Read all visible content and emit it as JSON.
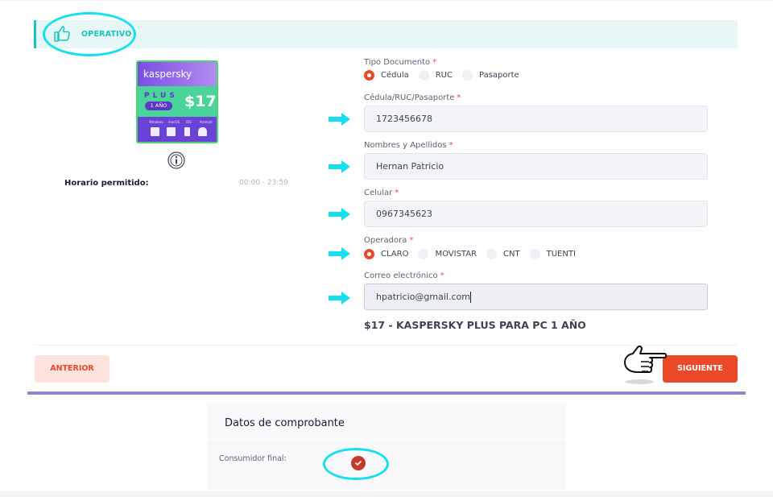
{
  "status": {
    "label": "OPERATIVO",
    "icon": "thumbs-up-icon"
  },
  "product": {
    "brand": "kaspersky",
    "plan": "PLUS",
    "duration": "1 AÑO",
    "price": "$17",
    "platforms": [
      "Windows",
      "macOS",
      "iOS",
      "Android"
    ]
  },
  "schedule": {
    "label": "Horario permitido:",
    "value": "00:00 - 23:59"
  },
  "form": {
    "doc_type": {
      "label": "Tipo Documento",
      "required_mark": "*",
      "options": [
        "Cédula",
        "RUC",
        "Pasaporte"
      ],
      "selected": "Cédula"
    },
    "doc_number": {
      "label": "Cédula/RUC/Pasaporte",
      "required_mark": "*",
      "value": "1723456678"
    },
    "name": {
      "label": "Nombres y Apellidos",
      "required_mark": "*",
      "value": "Hernan Patricio"
    },
    "phone": {
      "label": "Celular",
      "required_mark": "*",
      "value": "0967345623"
    },
    "operator": {
      "label": "Operadora",
      "required_mark": "*",
      "options": [
        "CLARO",
        "MOVISTAR",
        "CNT",
        "TUENTI"
      ],
      "selected": "CLARO"
    },
    "email": {
      "label": "Correo electrónico",
      "required_mark": "*",
      "value": "hpatricio@gmail.com"
    },
    "summary": "$17 - KASPERSKY PLUS PARA PC 1 AÑO"
  },
  "nav": {
    "prev_label": "ANTERIOR",
    "next_label": "SIGUIENTE"
  },
  "voucher": {
    "title": "Datos de comprobante",
    "final_consumer_label": "Consumidor final:",
    "final_consumer_checked": true
  },
  "colors": {
    "accent": "#ea4a2a",
    "success": "#1bc5bd",
    "highlight": "#14e0ee",
    "divider": "#8a88c8"
  }
}
